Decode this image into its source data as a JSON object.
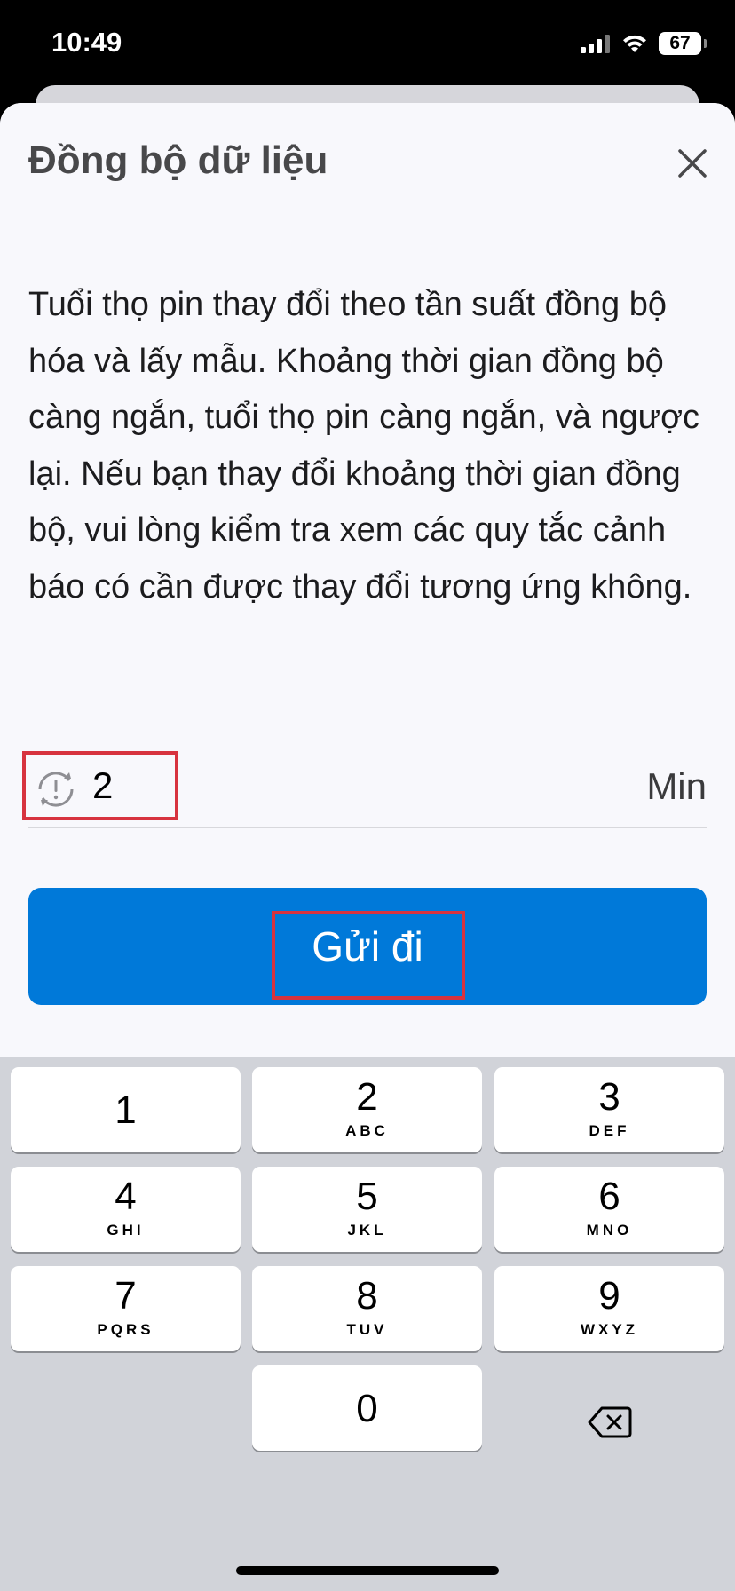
{
  "status_bar": {
    "time": "10:49",
    "battery": "67",
    "icons": [
      "signal-icon",
      "wifi-icon",
      "battery-icon"
    ]
  },
  "sheet": {
    "title": "Đồng bộ dữ liệu",
    "close_icon": "close-icon",
    "description": "Tuổi thọ pin thay đổi theo tần suất đồng bộ hóa và lấy mẫu. Khoảng thời gian đồng bộ càng ngắn, tuổi thọ pin càng ngắn, và ngược lại. Nếu bạn thay đổi khoảng thời gian đồng bộ, vui lòng kiểm tra xem các quy tắc cảnh báo có cần được thay đổi tương ứng không.",
    "interval": {
      "icon": "sync-alert-icon",
      "value": "2",
      "unit": "Min"
    },
    "submit_label": "Gửi đi"
  },
  "keyboard": {
    "keys": [
      {
        "digit": "1",
        "letters": ""
      },
      {
        "digit": "2",
        "letters": "ABC"
      },
      {
        "digit": "3",
        "letters": "DEF"
      },
      {
        "digit": "4",
        "letters": "GHI"
      },
      {
        "digit": "5",
        "letters": "JKL"
      },
      {
        "digit": "6",
        "letters": "MNO"
      },
      {
        "digit": "7",
        "letters": "PQRS"
      },
      {
        "digit": "8",
        "letters": "TUV"
      },
      {
        "digit": "9",
        "letters": "WXYZ"
      },
      {
        "digit": "0",
        "letters": ""
      }
    ],
    "delete_icon": "backspace-icon"
  },
  "colors": {
    "accent": "#0079d9",
    "highlight": "#d7333f",
    "sheet_bg": "#f8f8fc",
    "keyboard_bg": "#d1d3d9"
  }
}
